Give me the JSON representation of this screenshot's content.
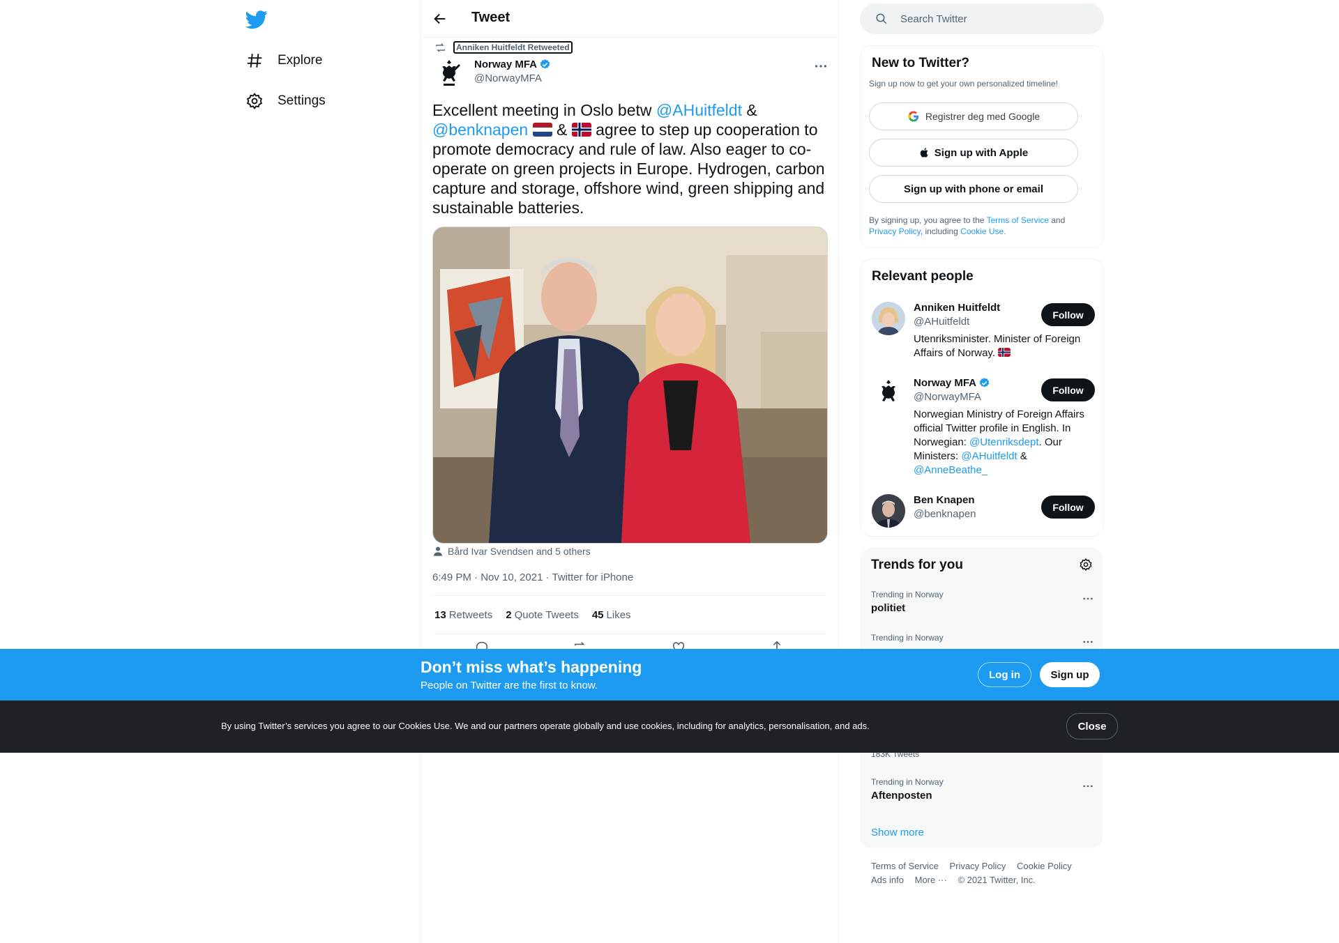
{
  "nav": {
    "items": [
      {
        "label": "Explore",
        "icon": "hashtag-icon"
      },
      {
        "label": "Settings",
        "icon": "gear-icon"
      }
    ]
  },
  "header": {
    "title": "Tweet"
  },
  "tweet": {
    "retweeted_by": "Anniken Huitfeldt Retweeted",
    "author_name": "Norway MFA",
    "author_handle": "@NorwayMFA",
    "text_part1": "Excellent meeting in Oslo betw ",
    "mention1": "@AHuitfeldt",
    "text_part2": " &",
    "mention2": "@benknapen",
    "text_part3": " & ",
    "text_part4": " agree to step up cooperation to promote democracy and rule of law. Also eager to co-operate on green projects in Europe. Hydrogen, carbon capture and storage, offshore wind, green shipping and sustainable batteries.",
    "tagged": "Bård Ivar Svendsen and 5 others",
    "meta": "6:49 PM · Nov 10, 2021 · Twitter for iPhone",
    "stats": [
      {
        "count": "13",
        "label": "Retweets"
      },
      {
        "count": "2",
        "label": "Quote Tweets"
      },
      {
        "count": "45",
        "label": "Likes"
      }
    ]
  },
  "search": {
    "placeholder": "Search Twitter"
  },
  "signup_card": {
    "title": "New to Twitter?",
    "subtitle": "Sign up now to get your own personalized timeline!",
    "google_label": "Registrer deg med Google",
    "apple_label": "Sign up with Apple",
    "phone_label": "Sign up with phone or email",
    "legal_1": "By signing up, you agree to the ",
    "legal_tos": "Terms of Service",
    "legal_2": " and ",
    "legal_privacy": "Privacy Policy",
    "legal_3": ", including ",
    "legal_cookie": "Cookie Use."
  },
  "relevant": {
    "title": "Relevant people",
    "people": [
      {
        "name": "Anniken Huitfeldt",
        "handle": "@AHuitfeldt",
        "bio": "Utenriksminister. Minister of Foreign Affairs of Norway. ",
        "follow": "Follow"
      },
      {
        "name": "Norway MFA",
        "handle": "@NorwayMFA",
        "bio_1": "Norwegian Ministry of Foreign Affairs official Twitter profile in English. In Norwegian: ",
        "bio_l1": "@Utenriksdept",
        "bio_2": ". Our Ministers: ",
        "bio_l2": "@AHuitfeldt",
        "bio_3": " & ",
        "bio_l3": "@AnneBeathe_",
        "follow": "Follow"
      },
      {
        "name": "Ben Knapen",
        "handle": "@benknapen",
        "follow": "Follow"
      }
    ]
  },
  "trends": {
    "title": "Trends for you",
    "items": [
      {
        "context": "Trending in Norway",
        "title": "politiet"
      },
      {
        "context": "Trending in Norway",
        "title": ""
      },
      {
        "context": "183K Tweets",
        "title": ""
      },
      {
        "context": "Trending in Norway",
        "title": "Aftenposten"
      }
    ],
    "show_more": "Show more"
  },
  "footer": {
    "links": [
      "Terms of Service",
      "Privacy Policy",
      "Cookie Policy",
      "Ads info",
      "More ···",
      "© 2021 Twitter, Inc."
    ]
  },
  "banner": {
    "heading": "Don’t miss what’s happening",
    "sub": "People on Twitter are the first to know.",
    "login": "Log in",
    "signup": "Sign up"
  },
  "cookie": {
    "text": "By using Twitter’s services you agree to our Cookies Use. We and our partners operate globally and use cookies, including for analytics, personalisation, and ads.",
    "close": "Close"
  },
  "colors": {
    "accent": "#1d9bf0",
    "text": "#0f1419",
    "muted": "#536471",
    "cookie_bg": "#1e2125"
  }
}
